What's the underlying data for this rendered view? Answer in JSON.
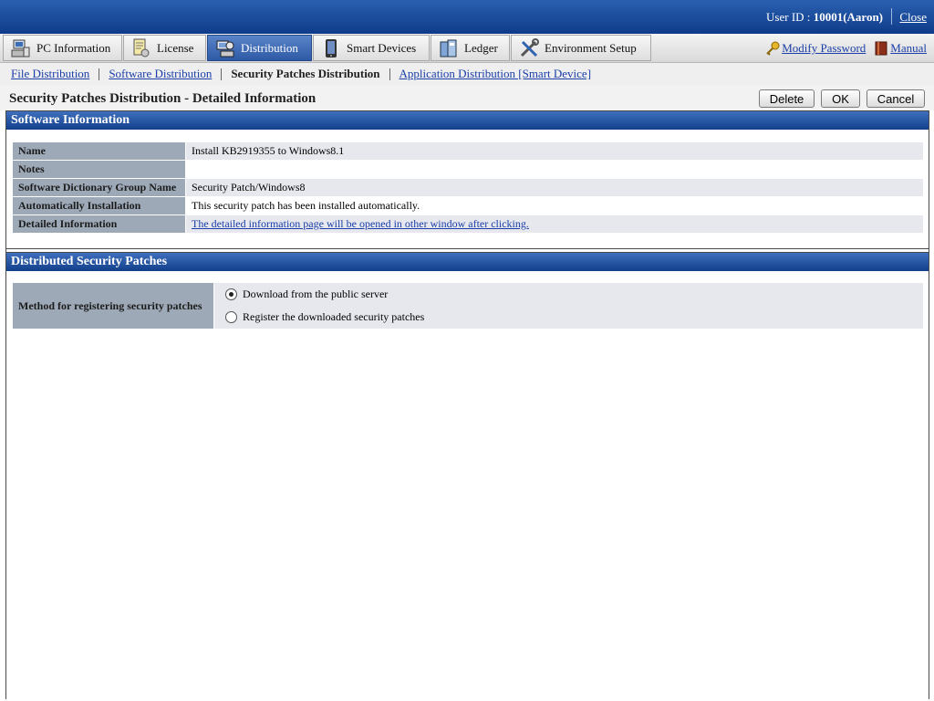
{
  "header": {
    "user_prefix": "User ID : ",
    "user_id": "10001(Aaron)",
    "close_label": "Close"
  },
  "tabs": [
    {
      "label": "PC Information",
      "icon": "pc-icon"
    },
    {
      "label": "License",
      "icon": "license-icon"
    },
    {
      "label": "Distribution",
      "icon": "distribution-icon"
    },
    {
      "label": "Smart Devices",
      "icon": "smartphone-icon"
    },
    {
      "label": "Ledger",
      "icon": "ledger-icon"
    },
    {
      "label": "Environment Setup",
      "icon": "tools-icon"
    }
  ],
  "active_tab": "Distribution",
  "right_links": {
    "modify_password": "Modify Password",
    "manual": "Manual"
  },
  "subnav": {
    "file_distribution": "File Distribution",
    "software_distribution": "Software Distribution",
    "security_patches_distribution": "Security Patches Distribution",
    "application_distribution": "Application Distribution [Smart Device]"
  },
  "page": {
    "title": "Security Patches Distribution - Detailed Information",
    "delete_label": "Delete",
    "ok_label": "OK",
    "cancel_label": "Cancel"
  },
  "software_info": {
    "heading": "Software Information",
    "rows": [
      {
        "label": "Name",
        "value": "Install KB2919355 to Windows8.1"
      },
      {
        "label": "Notes",
        "value": ""
      },
      {
        "label": "Software Dictionary Group Name",
        "value": "Security Patch/Windows8"
      },
      {
        "label": "Automatically Installation",
        "value": "This security patch has been installed automatically."
      },
      {
        "label": "Detailed Information",
        "value": "The detailed information page will be opened in other window after clicking."
      }
    ]
  },
  "distributed": {
    "heading": "Distributed Security Patches",
    "method_label": "Method for registering security patches",
    "options": [
      {
        "label": "Download from the public server",
        "selected": true
      },
      {
        "label": "Register the downloaded security patches",
        "selected": false
      }
    ]
  },
  "colors": {
    "header_blue": "#0f3c8a",
    "active_tab": "#2e5aa6",
    "link": "#1b3ea8",
    "label_cell": "#9ea9b8",
    "value_cell": "#e6e8ee"
  }
}
